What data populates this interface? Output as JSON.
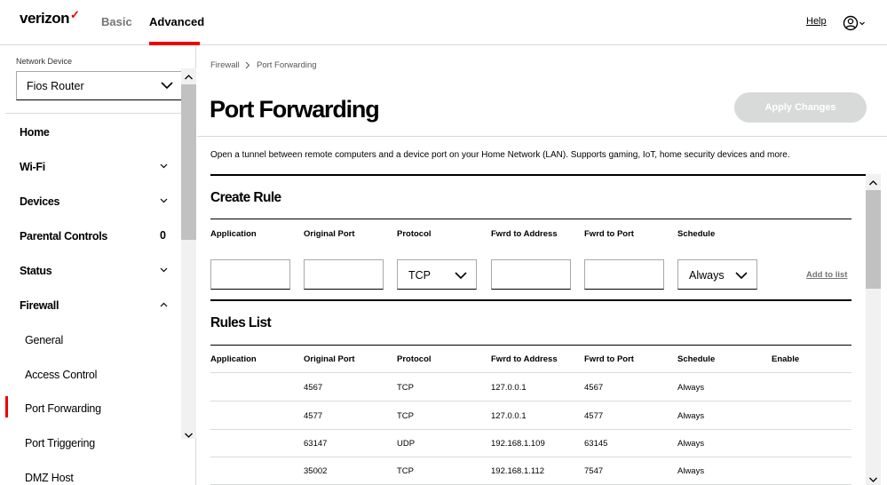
{
  "header": {
    "logo": "verizon",
    "logo_mark": "✓",
    "tabs": [
      {
        "label": "Basic"
      },
      {
        "label": "Advanced",
        "active": true
      }
    ],
    "help": "Help",
    "accent": "#ee0000"
  },
  "sidebar": {
    "network_device_label": "Network Device",
    "network_device_value": "Fios Router",
    "items": [
      {
        "label": "Home"
      },
      {
        "label": "Wi-Fi",
        "icon": "chevron-down-icon"
      },
      {
        "label": "Devices",
        "icon": "chevron-down-icon"
      },
      {
        "label": "Parental Controls",
        "badge": "0"
      },
      {
        "label": "Status",
        "icon": "chevron-down-icon"
      },
      {
        "label": "Firewall",
        "icon": "chevron-up-icon"
      },
      {
        "label": "General"
      },
      {
        "label": "Access Control"
      },
      {
        "label": "Port Forwarding",
        "active": true
      },
      {
        "label": "Port Triggering"
      },
      {
        "label": "DMZ Host"
      }
    ]
  },
  "breadcrumb": {
    "parent": "Firewall",
    "current": "Port Forwarding"
  },
  "page": {
    "title": "Port Forwarding",
    "apply_button": "Apply Changes",
    "description": "Open a tunnel between remote computers and a device port on your Home Network (LAN). Supports gaming, IoT, home security devices and more."
  },
  "create_rule": {
    "title": "Create Rule",
    "columns": [
      "Application",
      "Original Port",
      "Protocol",
      "Fwrd to Address",
      "Fwrd to Port",
      "Schedule"
    ],
    "protocol_value": "TCP",
    "schedule_value": "Always",
    "add_link": "Add to list"
  },
  "rules_list": {
    "title": "Rules List",
    "columns": [
      "Application",
      "Original Port",
      "Protocol",
      "Fwrd to Address",
      "Fwrd to Port",
      "Schedule",
      "Enable"
    ],
    "rows": [
      [
        "",
        "4567",
        "TCP",
        "127.0.0.1",
        "4567",
        "Always"
      ],
      [
        "",
        "4577",
        "TCP",
        "127.0.0.1",
        "4577",
        "Always"
      ],
      [
        "",
        "63147",
        "UDP",
        "192.168.1.109",
        "63145",
        "Always"
      ],
      [
        "",
        "35002",
        "TCP",
        "192.168.1.112",
        "7547",
        "Always"
      ]
    ]
  }
}
